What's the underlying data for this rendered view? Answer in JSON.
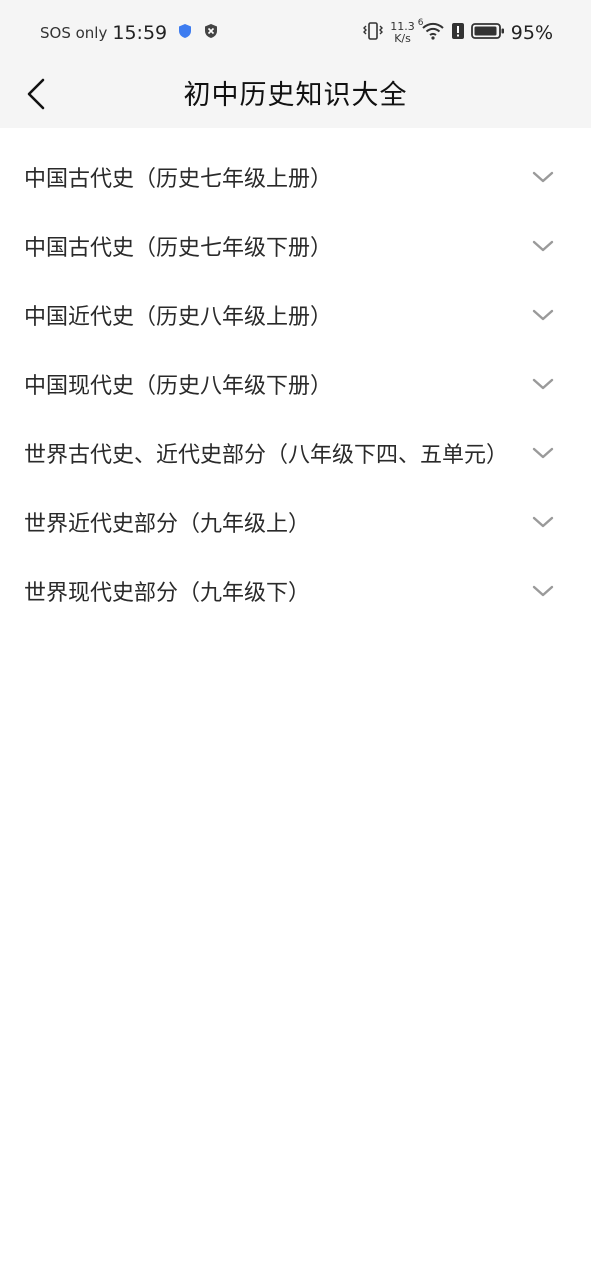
{
  "status_bar": {
    "network": "SOS only",
    "time": "15:59",
    "speed_value": "11.3",
    "speed_unit": "K/s",
    "signal_label": "6",
    "battery": "95%",
    "icons": [
      "shield-icon",
      "vpn-icon",
      "vibrate-icon",
      "wifi-icon",
      "alert-icon",
      "battery-icon"
    ]
  },
  "header": {
    "title": "初中历史知识大全",
    "back_icon": "chevron-left-icon"
  },
  "list": {
    "items": [
      {
        "label": "中国古代史（历史七年级上册）"
      },
      {
        "label": "中国古代史（历史七年级下册）"
      },
      {
        "label": "中国近代史（历史八年级上册）"
      },
      {
        "label": "中国现代史（历史八年级下册）"
      },
      {
        "label": "世界古代史、近代史部分（八年级下四、五单元）"
      },
      {
        "label": "世界近代史部分（九年级上）"
      },
      {
        "label": "世界现代史部分（九年级下）"
      }
    ],
    "expand_icon": "chevron-down-icon"
  },
  "colors": {
    "header_bg": "#f5f5f5",
    "page_bg": "#ffffff",
    "text": "#2a2a2a",
    "chevron": "#9a9a9a"
  }
}
